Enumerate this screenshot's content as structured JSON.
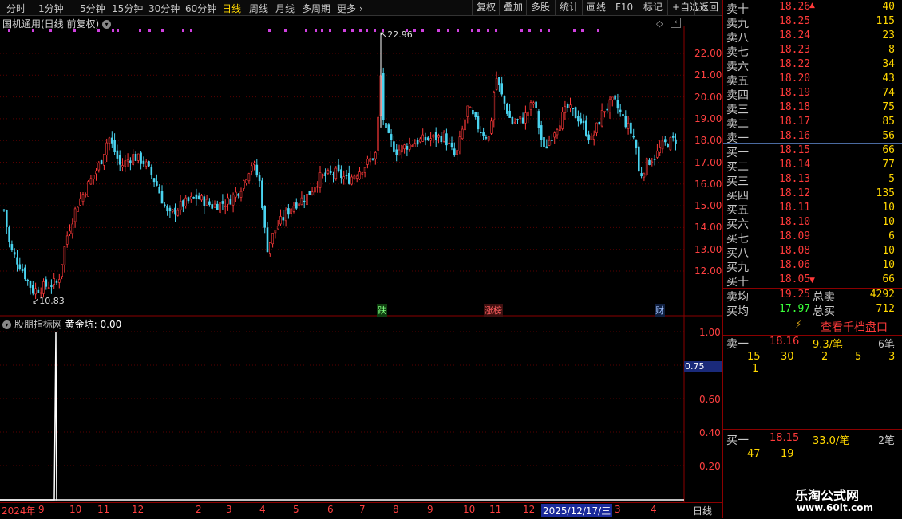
{
  "toolbar": {
    "periods": [
      "分时",
      "1分钟",
      "5分钟",
      "15分钟",
      "30分钟",
      "60分钟",
      "日线",
      "周线",
      "月线",
      "多周期",
      "更多"
    ],
    "active_period": "日线",
    "buttons": [
      "复权",
      "叠加",
      "多股",
      "统计",
      "画线",
      "F10",
      "标记",
      "+自选",
      "返回"
    ]
  },
  "main_chart": {
    "title": "国机通用(日线 前复权)",
    "high_label": "22.96",
    "low_label": "10.83",
    "y_ticks": [
      "22.00",
      "21.00",
      "20.00",
      "19.00",
      "18.00",
      "17.00",
      "16.00",
      "15.00",
      "14.00",
      "13.00",
      "12.00"
    ],
    "markers": [
      {
        "text": "跌",
        "color": "#7fff7f"
      },
      {
        "text": "涨榜",
        "color": "#ff6060"
      },
      {
        "text": "财",
        "color": "#a0c0ff"
      }
    ]
  },
  "indicator": {
    "name": "股朋指标网",
    "label": "黄金坑:",
    "value": "0.00",
    "y_ticks": [
      "1.00",
      "0.80",
      "0.60",
      "0.40",
      "0.20"
    ],
    "cursor_value": "0.75"
  },
  "time_axis": {
    "labels": [
      "2024年",
      "9",
      "10",
      "11",
      "12",
      "2",
      "3",
      "4",
      "5",
      "6",
      "7",
      "8",
      "9",
      "10",
      "11",
      "12"
    ],
    "cursor_date": "2025/12/17/三",
    "after_cursor": [
      "3",
      "4"
    ],
    "period_label": "日线"
  },
  "orderbook": {
    "asks": [
      {
        "name": "卖十",
        "price": "18.26",
        "vol": "40"
      },
      {
        "name": "卖九",
        "price": "18.25",
        "vol": "115"
      },
      {
        "name": "卖八",
        "price": "18.24",
        "vol": "23"
      },
      {
        "name": "卖七",
        "price": "18.23",
        "vol": "8"
      },
      {
        "name": "卖六",
        "price": "18.22",
        "vol": "34"
      },
      {
        "name": "卖五",
        "price": "18.20",
        "vol": "43"
      },
      {
        "name": "卖四",
        "price": "18.19",
        "vol": "74"
      },
      {
        "name": "卖三",
        "price": "18.18",
        "vol": "75"
      },
      {
        "name": "卖二",
        "price": "18.17",
        "vol": "85"
      },
      {
        "name": "卖一",
        "price": "18.16",
        "vol": "56"
      }
    ],
    "bids": [
      {
        "name": "买一",
        "price": "18.15",
        "vol": "66"
      },
      {
        "name": "买二",
        "price": "18.14",
        "vol": "77"
      },
      {
        "name": "买三",
        "price": "18.13",
        "vol": "5"
      },
      {
        "name": "买四",
        "price": "18.12",
        "vol": "135"
      },
      {
        "name": "买五",
        "price": "18.11",
        "vol": "10"
      },
      {
        "name": "买六",
        "price": "18.10",
        "vol": "10"
      },
      {
        "name": "买七",
        "price": "18.09",
        "vol": "6"
      },
      {
        "name": "买八",
        "price": "18.08",
        "vol": "10"
      },
      {
        "name": "买九",
        "price": "18.06",
        "vol": "10"
      },
      {
        "name": "买十",
        "price": "18.05",
        "vol": "66"
      }
    ],
    "avg_ask_label": "卖均",
    "avg_ask": "19.25",
    "total_ask_label": "总卖",
    "total_ask": "4292",
    "avg_bid_label": "买均",
    "avg_bid": "17.97",
    "total_bid_label": "总买",
    "total_bid": "712",
    "thousand_link": "查看千档盘口",
    "ask1": {
      "label": "卖一",
      "price": "18.16",
      "per": "9.3/笔",
      "count": "6笔",
      "orders": [
        "15",
        "30",
        "2",
        "5",
        "3"
      ],
      "orders2": [
        "1"
      ]
    },
    "bid1": {
      "label": "买一",
      "price": "18.15",
      "per": "33.0/笔",
      "count": "2笔",
      "orders": [
        "47",
        "19"
      ]
    }
  },
  "watermark": {
    "line1": "乐淘公式网",
    "line2": "www.60lt.com"
  }
}
